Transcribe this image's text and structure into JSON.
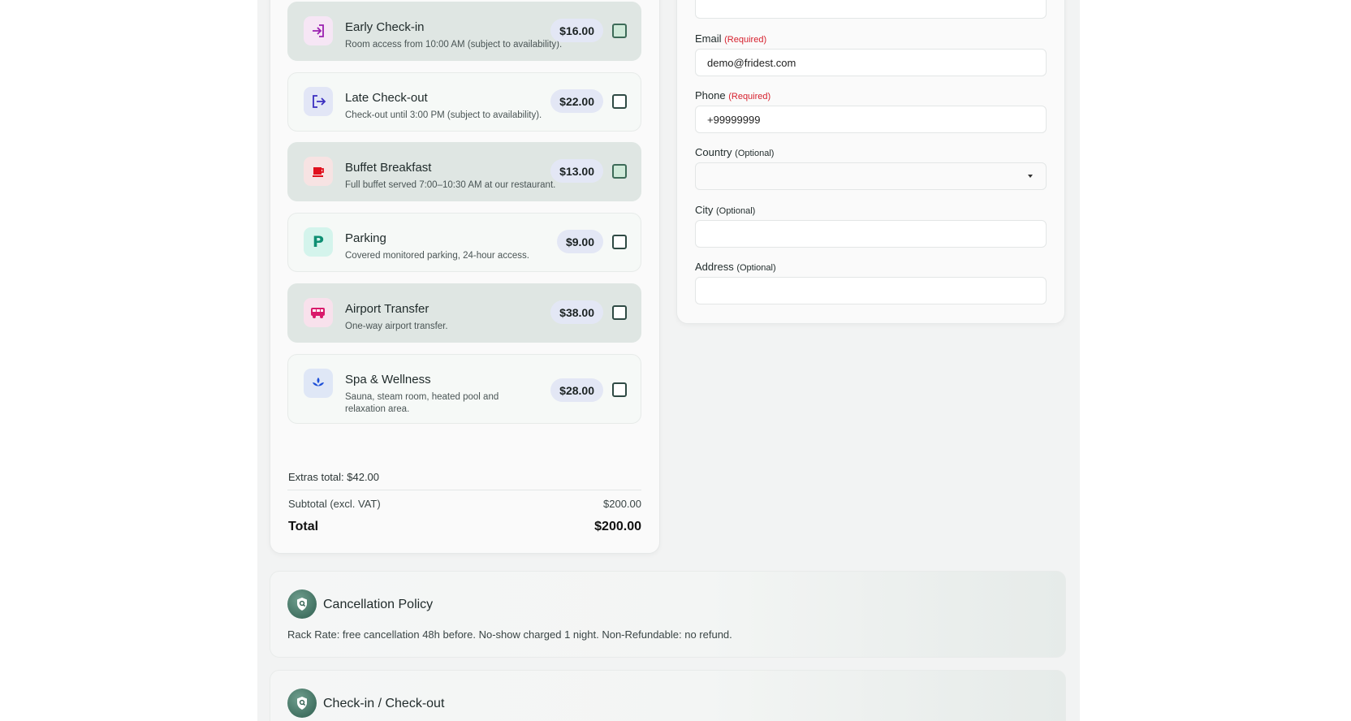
{
  "extras": [
    {
      "name": "Early Check-in",
      "desc": "Room access from 10:00 AM (subject to availability).",
      "price": "$16.00",
      "selected": true,
      "icon": "login-icon"
    },
    {
      "name": "Late Check-out",
      "desc": "Check-out until 3:00 PM (subject to availability).",
      "price": "$22.00",
      "selected": false,
      "icon": "logout-icon"
    },
    {
      "name": "Buffet Breakfast",
      "desc": "Full buffet served 7:00–10:30 AM at our restaurant.",
      "price": "$13.00",
      "selected": true,
      "icon": "coffee-cup-icon"
    },
    {
      "name": "Parking",
      "desc": "Covered monitored parking, 24-hour access.",
      "price": "$9.00",
      "selected": false,
      "icon": "parking-icon"
    },
    {
      "name": "Airport Transfer",
      "desc": "One-way airport transfer.",
      "price": "$38.00",
      "selected": false,
      "icon": "bus-icon"
    },
    {
      "name": "Spa & Wellness",
      "desc": "Sauna, steam room, heated pool and relaxation area.",
      "price": "$28.00",
      "selected": false,
      "icon": "spa-icon"
    }
  ],
  "totals": {
    "extras_total": "Extras total: $42.00",
    "subtotal_label": "Subtotal (excl. VAT)",
    "subtotal_value": "$200.00",
    "total_label": "Total",
    "total_value": "$200.00"
  },
  "form": {
    "email_label": "Email",
    "email_req": "(Required)",
    "email_value": "demo@fridest.com",
    "phone_label": "Phone",
    "phone_req": "(Required)",
    "phone_value": "+99999999",
    "country_label": "Country",
    "country_opt": "(Optional)",
    "country_value": "",
    "city_label": "City",
    "city_opt": "(Optional)",
    "city_value": "",
    "address_label": "Address",
    "address_opt": "(Optional)",
    "address_value": ""
  },
  "policies": {
    "cancellation_title": "Cancellation Policy",
    "cancellation_text": "Rack Rate: free cancellation 48h before. No-show charged 1 night. Non-Refundable: no refund.",
    "checkin_title": "Check-in / Check-out"
  },
  "colors": {
    "selected_bg": "#dfe6e3",
    "required": "#d61f2c",
    "price_badge": "#e3e7f5"
  }
}
